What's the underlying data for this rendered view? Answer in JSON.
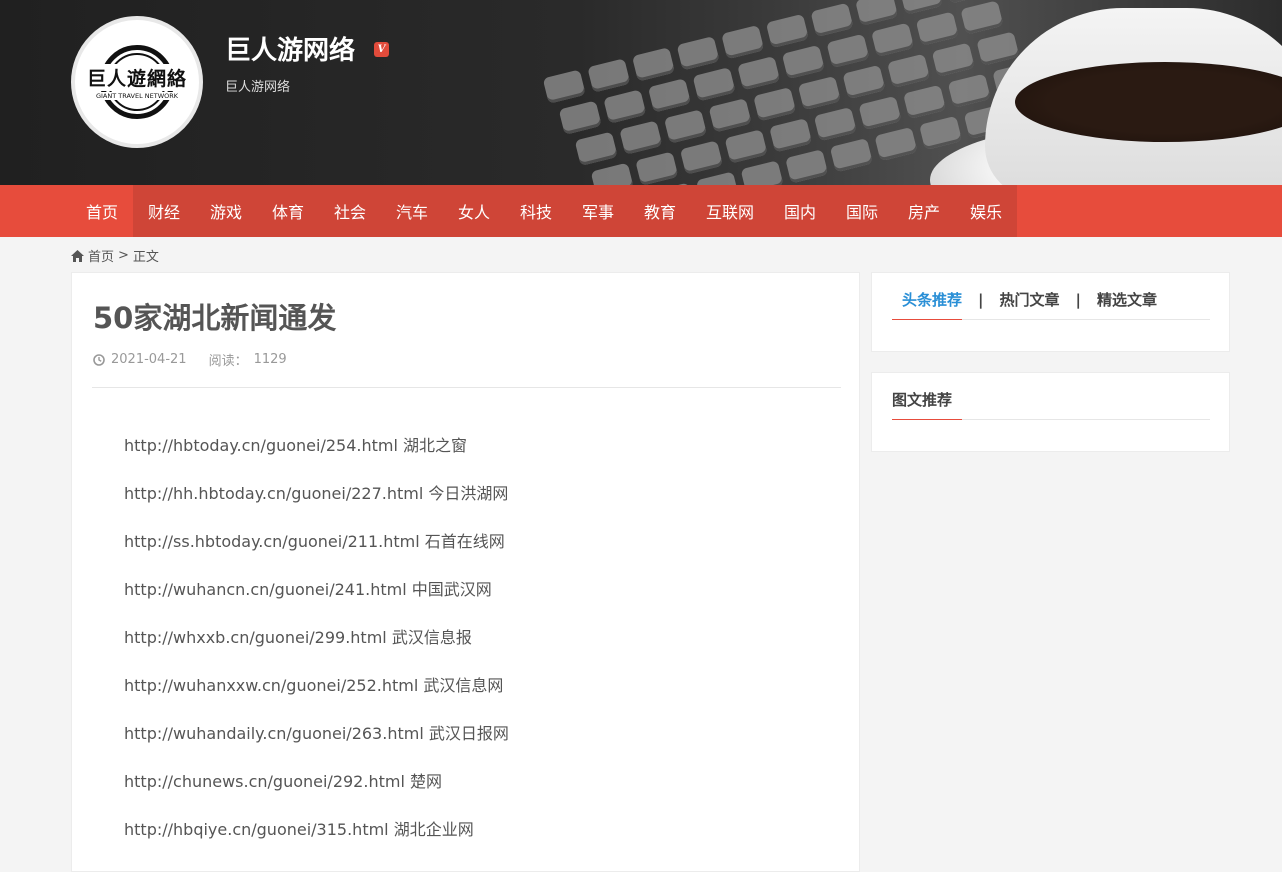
{
  "header": {
    "logo_text": "巨人遊網絡",
    "logo_subtext": "GIANT TRAVEL NETWORK",
    "site_title": "巨人游网络",
    "verified_badge": "V",
    "site_subtitle": "巨人游网络"
  },
  "nav": {
    "items": [
      "首页",
      "财经",
      "游戏",
      "体育",
      "社会",
      "汽车",
      "女人",
      "科技",
      "军事",
      "教育",
      "互联网",
      "国内",
      "国际",
      "房产",
      "娱乐"
    ],
    "active_index": 0
  },
  "breadcrumb": {
    "home": "首页",
    "separator": ">",
    "current": "正文"
  },
  "article": {
    "title": "50家湖北新闻通发",
    "date": "2021-04-21",
    "read_label": "阅读：",
    "read_count": "1129",
    "lines": [
      "http://hbtoday.cn/guonei/254.html 湖北之窗",
      "http://hh.hbtoday.cn/guonei/227.html 今日洪湖网",
      "http://ss.hbtoday.cn/guonei/211.html 石首在线网",
      "http://wuhancn.cn/guonei/241.html 中国武汉网",
      "http://whxxb.cn/guonei/299.html 武汉信息报",
      "http://wuhanxxw.cn/guonei/252.html 武汉信息网",
      "http://wuhandaily.cn/guonei/263.html 武汉日报网",
      "http://chunews.cn/guonei/292.html 楚网",
      "http://hbqiye.cn/guonei/315.html 湖北企业网"
    ]
  },
  "sidebar": {
    "tabs": [
      "头条推荐",
      "热门文章",
      "精选文章"
    ],
    "tab_separator": "|",
    "active_tab": 0,
    "widget2_title": "图文推荐"
  },
  "colors": {
    "nav_bg": "#e74c3c",
    "nav_group_bg": "#cf4537",
    "active_tab": "#2a8fd6",
    "page_bg": "#f4f4f4"
  }
}
